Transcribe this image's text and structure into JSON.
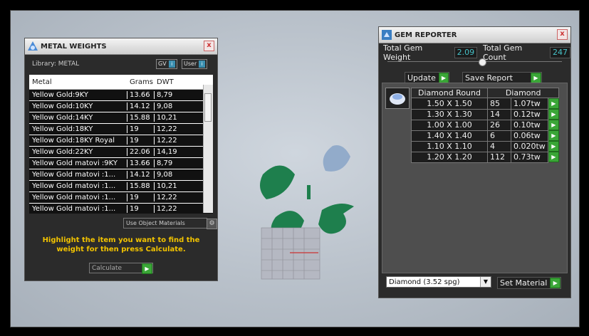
{
  "metal_weights": {
    "title": "METAL WEIGHTS",
    "library": "Library: METAL",
    "tag_gv": "GV",
    "tag_user": "User",
    "columns": [
      "Metal",
      "Grams",
      "DWT"
    ],
    "rows": [
      [
        "Yellow Gold:9KY",
        "13.66",
        "8,79"
      ],
      [
        "Yellow Gold:10KY",
        "14.12",
        "9,08"
      ],
      [
        "Yellow Gold:14KY",
        "15.88",
        "10,21"
      ],
      [
        "Yellow Gold:18KY",
        "19",
        "12,22"
      ],
      [
        "Yellow Gold:18KY Royal",
        "19",
        "12,22"
      ],
      [
        "Yellow Gold:22KY",
        "22.06",
        "14,19"
      ],
      [
        "Yellow Gold matovi :9KY",
        "13.66",
        "8,79"
      ],
      [
        "Yellow Gold matovi :1...",
        "14.12",
        "9,08"
      ],
      [
        "Yellow Gold matovi :1...",
        "15.88",
        "10,21"
      ],
      [
        "Yellow Gold matovi :1...",
        "19",
        "12,22"
      ],
      [
        "Yellow Gold matovi :1...",
        "19",
        "12,22"
      ]
    ],
    "use_object": "Use Object Materials",
    "hint": "Highlight the item you want to find the weight for then press Calculate.",
    "calculate": "Calculate"
  },
  "gem_reporter": {
    "title": "GEM REPORTER",
    "total_weight_label": "Total Gem Weight",
    "total_weight": "2.09",
    "total_count_label": "Total Gem Count",
    "total_count": "247",
    "update": "Update",
    "save_report": "Save Report",
    "headers": [
      "Diamond Round",
      "Diamond"
    ],
    "rows": [
      [
        "1.50 X 1.50",
        "85",
        "1.07tw"
      ],
      [
        "1.30 X 1.30",
        "14",
        "0.12tw"
      ],
      [
        "1.00 X 1.00",
        "26",
        "0.10tw"
      ],
      [
        "1.40 X 1.40",
        "6",
        "0.06tw"
      ],
      [
        "1.10 X 1.10",
        "4",
        "0.020tw"
      ],
      [
        "1.20 X 1.20",
        "112",
        "0.73tw"
      ]
    ],
    "material": "Diamond    (3.52 spg)",
    "set_material": "Set Material"
  },
  "icons": {
    "arrow": "▶",
    "dropdown": "▼",
    "close": "x",
    "info": "i",
    "gear": "⚙",
    "scroll_up": "▲",
    "scroll_down": "▼"
  },
  "colors": {
    "accent_green": "#3aa637",
    "hint_yellow": "#f2c300",
    "value_cyan": "#46c2c8"
  }
}
